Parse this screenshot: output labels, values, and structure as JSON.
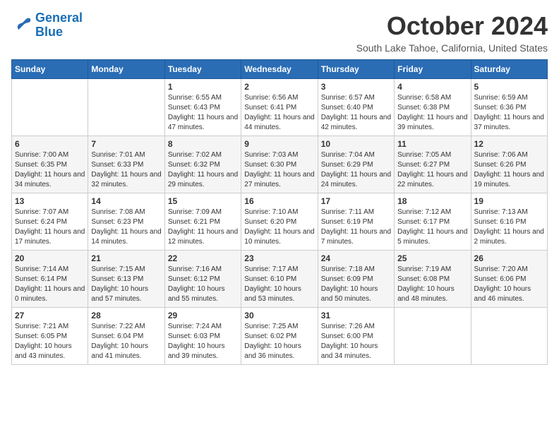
{
  "header": {
    "logo_line1": "General",
    "logo_line2": "Blue",
    "month_title": "October 2024",
    "location": "South Lake Tahoe, California, United States"
  },
  "weekdays": [
    "Sunday",
    "Monday",
    "Tuesday",
    "Wednesday",
    "Thursday",
    "Friday",
    "Saturday"
  ],
  "weeks": [
    [
      {
        "day": "",
        "info": ""
      },
      {
        "day": "",
        "info": ""
      },
      {
        "day": "1",
        "info": "Sunrise: 6:55 AM\nSunset: 6:43 PM\nDaylight: 11 hours and 47 minutes."
      },
      {
        "day": "2",
        "info": "Sunrise: 6:56 AM\nSunset: 6:41 PM\nDaylight: 11 hours and 44 minutes."
      },
      {
        "day": "3",
        "info": "Sunrise: 6:57 AM\nSunset: 6:40 PM\nDaylight: 11 hours and 42 minutes."
      },
      {
        "day": "4",
        "info": "Sunrise: 6:58 AM\nSunset: 6:38 PM\nDaylight: 11 hours and 39 minutes."
      },
      {
        "day": "5",
        "info": "Sunrise: 6:59 AM\nSunset: 6:36 PM\nDaylight: 11 hours and 37 minutes."
      }
    ],
    [
      {
        "day": "6",
        "info": "Sunrise: 7:00 AM\nSunset: 6:35 PM\nDaylight: 11 hours and 34 minutes."
      },
      {
        "day": "7",
        "info": "Sunrise: 7:01 AM\nSunset: 6:33 PM\nDaylight: 11 hours and 32 minutes."
      },
      {
        "day": "8",
        "info": "Sunrise: 7:02 AM\nSunset: 6:32 PM\nDaylight: 11 hours and 29 minutes."
      },
      {
        "day": "9",
        "info": "Sunrise: 7:03 AM\nSunset: 6:30 PM\nDaylight: 11 hours and 27 minutes."
      },
      {
        "day": "10",
        "info": "Sunrise: 7:04 AM\nSunset: 6:29 PM\nDaylight: 11 hours and 24 minutes."
      },
      {
        "day": "11",
        "info": "Sunrise: 7:05 AM\nSunset: 6:27 PM\nDaylight: 11 hours and 22 minutes."
      },
      {
        "day": "12",
        "info": "Sunrise: 7:06 AM\nSunset: 6:26 PM\nDaylight: 11 hours and 19 minutes."
      }
    ],
    [
      {
        "day": "13",
        "info": "Sunrise: 7:07 AM\nSunset: 6:24 PM\nDaylight: 11 hours and 17 minutes."
      },
      {
        "day": "14",
        "info": "Sunrise: 7:08 AM\nSunset: 6:23 PM\nDaylight: 11 hours and 14 minutes."
      },
      {
        "day": "15",
        "info": "Sunrise: 7:09 AM\nSunset: 6:21 PM\nDaylight: 11 hours and 12 minutes."
      },
      {
        "day": "16",
        "info": "Sunrise: 7:10 AM\nSunset: 6:20 PM\nDaylight: 11 hours and 10 minutes."
      },
      {
        "day": "17",
        "info": "Sunrise: 7:11 AM\nSunset: 6:19 PM\nDaylight: 11 hours and 7 minutes."
      },
      {
        "day": "18",
        "info": "Sunrise: 7:12 AM\nSunset: 6:17 PM\nDaylight: 11 hours and 5 minutes."
      },
      {
        "day": "19",
        "info": "Sunrise: 7:13 AM\nSunset: 6:16 PM\nDaylight: 11 hours and 2 minutes."
      }
    ],
    [
      {
        "day": "20",
        "info": "Sunrise: 7:14 AM\nSunset: 6:14 PM\nDaylight: 11 hours and 0 minutes."
      },
      {
        "day": "21",
        "info": "Sunrise: 7:15 AM\nSunset: 6:13 PM\nDaylight: 10 hours and 57 minutes."
      },
      {
        "day": "22",
        "info": "Sunrise: 7:16 AM\nSunset: 6:12 PM\nDaylight: 10 hours and 55 minutes."
      },
      {
        "day": "23",
        "info": "Sunrise: 7:17 AM\nSunset: 6:10 PM\nDaylight: 10 hours and 53 minutes."
      },
      {
        "day": "24",
        "info": "Sunrise: 7:18 AM\nSunset: 6:09 PM\nDaylight: 10 hours and 50 minutes."
      },
      {
        "day": "25",
        "info": "Sunrise: 7:19 AM\nSunset: 6:08 PM\nDaylight: 10 hours and 48 minutes."
      },
      {
        "day": "26",
        "info": "Sunrise: 7:20 AM\nSunset: 6:06 PM\nDaylight: 10 hours and 46 minutes."
      }
    ],
    [
      {
        "day": "27",
        "info": "Sunrise: 7:21 AM\nSunset: 6:05 PM\nDaylight: 10 hours and 43 minutes."
      },
      {
        "day": "28",
        "info": "Sunrise: 7:22 AM\nSunset: 6:04 PM\nDaylight: 10 hours and 41 minutes."
      },
      {
        "day": "29",
        "info": "Sunrise: 7:24 AM\nSunset: 6:03 PM\nDaylight: 10 hours and 39 minutes."
      },
      {
        "day": "30",
        "info": "Sunrise: 7:25 AM\nSunset: 6:02 PM\nDaylight: 10 hours and 36 minutes."
      },
      {
        "day": "31",
        "info": "Sunrise: 7:26 AM\nSunset: 6:00 PM\nDaylight: 10 hours and 34 minutes."
      },
      {
        "day": "",
        "info": ""
      },
      {
        "day": "",
        "info": ""
      }
    ]
  ]
}
